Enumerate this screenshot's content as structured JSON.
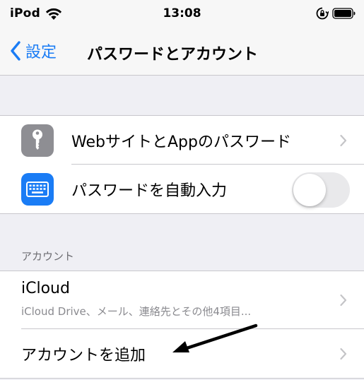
{
  "status_bar": {
    "carrier": "iPod",
    "time": "13:08"
  },
  "nav": {
    "back_label": "設定",
    "title": "パスワードとアカウント"
  },
  "passwords_group": {
    "items": [
      {
        "label": "WebサイトとAppのパスワード",
        "icon": "key-icon",
        "icon_color": "#8e8e93",
        "accessory": "chevron"
      },
      {
        "label": "パスワードを自動入力",
        "icon": "keyboard-icon",
        "icon_color": "#1a7cf5",
        "accessory": "toggle",
        "toggle_on": false
      }
    ]
  },
  "accounts_section": {
    "header": "アカウント",
    "items": [
      {
        "title": "iCloud",
        "subtitle": "iCloud Drive、メール、連絡先とその他4項目..."
      },
      {
        "title": "アカウントを追加"
      }
    ]
  },
  "colors": {
    "accent": "#1a7cf5",
    "background": "#efeff4",
    "separator": "#c8c7cc",
    "secondary_text": "#8a8a8f"
  }
}
